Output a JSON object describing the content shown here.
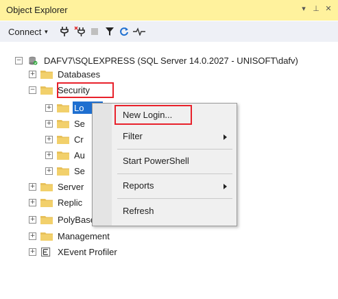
{
  "panel": {
    "title": "Object Explorer"
  },
  "toolbar": {
    "connect_label": "Connect"
  },
  "tree": {
    "server": "DAFV7\\SQLEXPRESS (SQL Server 14.0.2027 - UNISOFT\\dafv)",
    "databases": "Databases",
    "security": "Security",
    "security_children": [
      "Lo",
      "Se",
      "Cr",
      "Au",
      "Se"
    ],
    "server_objects": "Server",
    "replication": "Replic",
    "polybase": "PolyBase",
    "management": "Management",
    "xevent": "XEvent Profiler"
  },
  "context_menu": {
    "items": [
      "New Login...",
      "Filter",
      "Start PowerShell",
      "Reports",
      "Refresh"
    ]
  },
  "colors": {
    "highlight_red": "#e8202a",
    "selection_blue": "#1e6fd0",
    "title_bg": "#fff29d"
  }
}
